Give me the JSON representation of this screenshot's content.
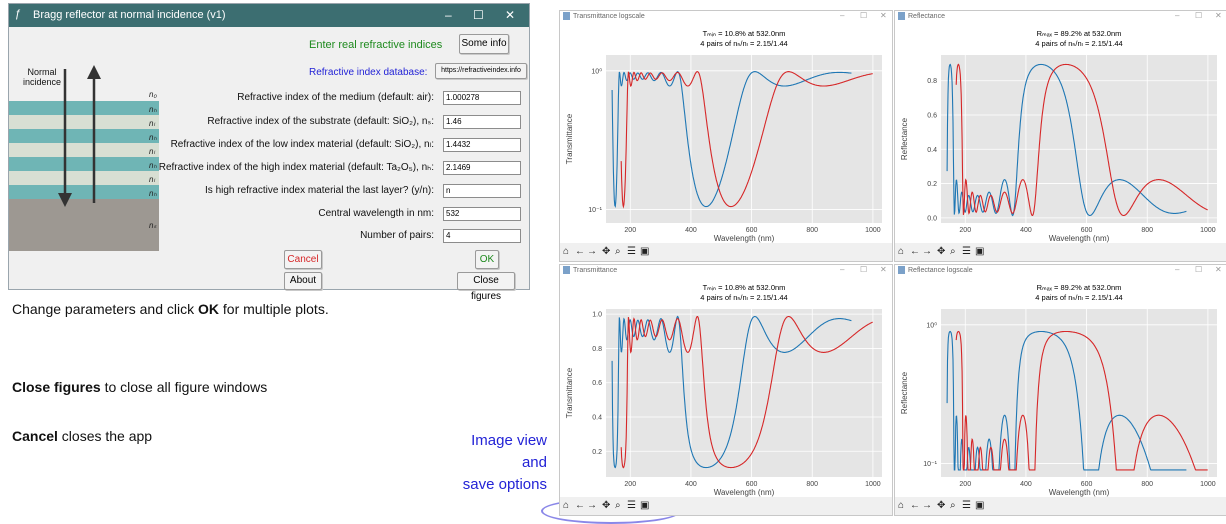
{
  "app": {
    "title": "Bragg reflector at normal incidence (v1)",
    "header": "Enter real refractive indices",
    "some_info": "Some info",
    "db_label": "Refractive index database:",
    "db_button": "https://refractiveindex.info",
    "normal_incidence": "Normal\nincidence",
    "layer_labels": [
      "n₀",
      "nₕ",
      "nₗ",
      "nₕ",
      "nₗ",
      "nₕ",
      "nₗ",
      "nₕ",
      "nₛ"
    ],
    "fields": [
      {
        "label": "Refractive index of the medium (default: air):",
        "value": "1.000278"
      },
      {
        "label": "Refractive index of the substrate (default: SiO₂), nₛ:",
        "value": "1.46"
      },
      {
        "label": "Refractive index of the low index material (default: SiO₂), nₗ:",
        "value": "1.4432"
      },
      {
        "label": "Refractive index of the high index material (default: Ta₂O₅), nₕ:",
        "value": "2.1469"
      },
      {
        "label": "Is high refractive index material the last layer? (y/n):",
        "value": "n"
      },
      {
        "label": "Central wavelength in nm:",
        "value": "532"
      },
      {
        "label": "Number of pairs:",
        "value": "4"
      }
    ],
    "cancel": "Cancel",
    "ok": "OK",
    "about": "About",
    "close_figures": "Close figures",
    "colors": {
      "title_bar": "#3c6e71",
      "green": "#1e8a1e",
      "red": "#d62728",
      "blue": "#2323d6"
    }
  },
  "side": {
    "p1_a": "Change  parameters and click ",
    "p1_b": "OK",
    "p1_c": " for multiple plots.",
    "p2_a": "Close figures",
    "p2_b": " to close all figure windows",
    "p3_a": "Cancel",
    "p3_b": " closes the app",
    "note": "Image view\nand\nsave options"
  },
  "toolbar_icons": [
    "home-icon",
    "back-icon",
    "forward-icon",
    "pan-icon",
    "zoom-icon",
    "configure-icon",
    "save-icon"
  ],
  "figures": [
    {
      "window_title": "Transmittance logscale",
      "title1": "Tₘᵢₙ = 10.8% at 532.0nm",
      "title2": "4 pairs of nₕ/nₗ = 2.15/1.44",
      "ylabel": "Transmittance",
      "xlabel": "Wavelength (nm)"
    },
    {
      "window_title": "Reflectance",
      "title1": "Rₘₐₓ = 89.2% at 532.0nm",
      "title2": "4 pairs of nₕ/nₗ = 2.15/1.44",
      "ylabel": "Reflectance",
      "xlabel": "Wavelength (nm)"
    },
    {
      "window_title": "Transmittance",
      "title1": "Tₘᵢₙ = 10.8% at 532.0nm",
      "title2": "4 pairs of nₕ/nₗ = 2.15/1.44",
      "ylabel": "Transmittance",
      "xlabel": "Wavelength (nm)"
    },
    {
      "window_title": "Reflectance logscale",
      "title1": "Rₘₐₓ = 89.2% at 532.0nm",
      "title2": "4 pairs of nₕ/nₗ = 2.15/1.44",
      "ylabel": "Reflectance",
      "xlabel": "Wavelength (nm)"
    }
  ],
  "chart_data": [
    {
      "type": "line",
      "xlabel": "Wavelength (nm)",
      "ylabel": "Transmittance",
      "xticks": [
        "200",
        "400",
        "600",
        "800",
        "1000"
      ],
      "yticks": [
        "10⁻¹",
        "10⁰"
      ],
      "log": true,
      "xlim": [
        120,
        1030
      ],
      "series_colors": [
        "#1f77b4",
        "#d62728"
      ]
    },
    {
      "type": "line",
      "xlabel": "Wavelength (nm)",
      "ylabel": "Reflectance",
      "xticks": [
        "200",
        "400",
        "600",
        "800",
        "1000"
      ],
      "yticks": [
        "0.0",
        "0.2",
        "0.4",
        "0.6",
        "0.8"
      ],
      "log": false,
      "xlim": [
        120,
        1030
      ],
      "ylim": [
        -0.03,
        0.95
      ],
      "series_colors": [
        "#1f77b4",
        "#d62728"
      ]
    },
    {
      "type": "line",
      "xlabel": "Wavelength (nm)",
      "ylabel": "Transmittance",
      "xticks": [
        "200",
        "400",
        "600",
        "800",
        "1000"
      ],
      "yticks": [
        "0.2",
        "0.4",
        "0.6",
        "0.8",
        "1.0"
      ],
      "log": false,
      "xlim": [
        120,
        1030
      ],
      "ylim": [
        0.05,
        1.03
      ],
      "series_colors": [
        "#1f77b4",
        "#d62728"
      ]
    },
    {
      "type": "line",
      "xlabel": "Wavelength (nm)",
      "ylabel": "Reflectance",
      "xticks": [
        "200",
        "400",
        "600",
        "800",
        "1000"
      ],
      "yticks": [
        "10⁻¹",
        "10⁰"
      ],
      "log": true,
      "xlim": [
        120,
        1030
      ],
      "series_colors": [
        "#1f77b4",
        "#d62728"
      ]
    }
  ]
}
